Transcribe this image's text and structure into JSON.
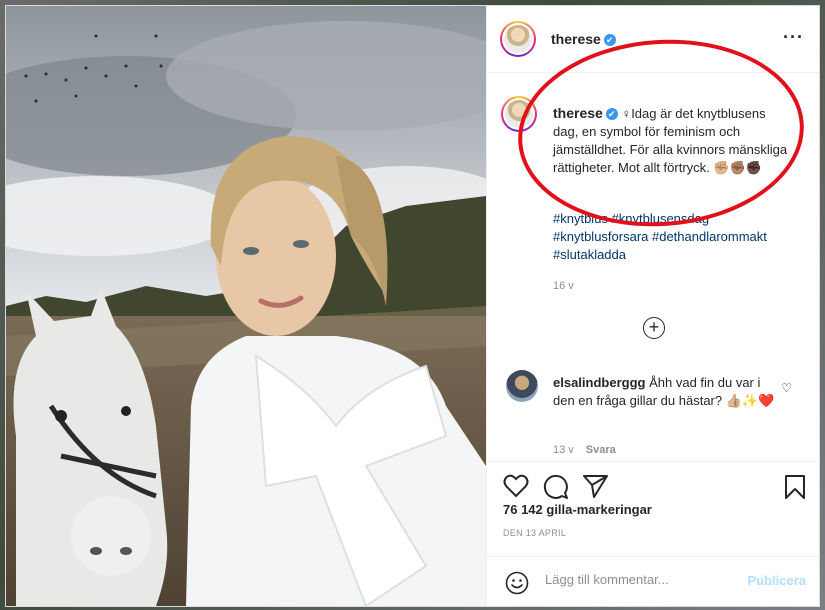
{
  "post": {
    "username": "therese",
    "verified_mark": "✔",
    "more_icon": "more-options-icon",
    "caption": {
      "username": "therese",
      "text": "♀Idag är det knytblusens dag, en symbol för feminism och jämställdhet. För alla kvinnors mänskliga rättigheter. Mot allt förtryck. ✊🏼✊🏽✊🏿",
      "hashtags": "#knytblus #knytblusensdag #knytblusforsara #dethandlarommakt #slutakladda",
      "time": "16 v"
    },
    "load_more_icon": "plus-circle-icon",
    "comment": {
      "username": "elsalindberggg",
      "text": "Åhh vad fin du var i den en fråga gillar du hästar? 👍🏼✨❤️",
      "time": "13 v",
      "reply": "Svara"
    },
    "likes": "76 142 gilla-markeringar",
    "date": "DEN 13 APRIL",
    "add_comment_placeholder": "Lägg till kommentar...",
    "publish_label": "Publicera"
  },
  "colors": {
    "annotation": "#e3101a",
    "link": "#00376b",
    "publish_disabled": "#b2dffc",
    "verified": "#3897f0"
  }
}
